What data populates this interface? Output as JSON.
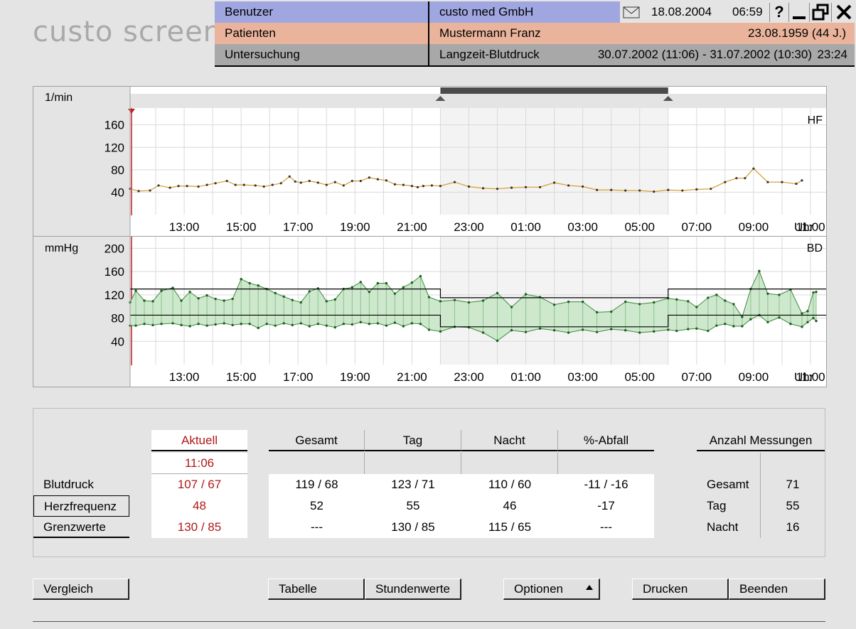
{
  "app": {
    "logo": "custo screen"
  },
  "header": {
    "row1": {
      "label": "Benutzer",
      "value": "custo med GmbH",
      "date": "18.08.2004",
      "time": "06:59"
    },
    "row2": {
      "label": "Patienten",
      "value": "Mustermann Franz",
      "dob": "23.08.1959 (44 J.)"
    },
    "row3": {
      "label": "Untersuchung",
      "value": "Langzeit-Blutdruck",
      "range": "30.07.2002 (11:06) - 31.07.2002 (10:30)",
      "duration": "23:24"
    },
    "icons": {
      "mail": "envelope-icon",
      "help": "?",
      "minimize": "minimize-icon",
      "restore": "restore-icon",
      "close": "close-icon"
    }
  },
  "colors": {
    "hf_line": "#d79a2c",
    "bp_fill": "#cde8cd",
    "bp_line": "#3d8a3d",
    "bp_dark": "#1f5f1f",
    "night_shade": "#f3f3f3",
    "accent_red": "#b01717"
  },
  "chart_data": [
    {
      "type": "line",
      "ylabel": "1/min",
      "tag": "HF",
      "xunit": "Uhr",
      "xticks": [
        "13:00",
        "15:00",
        "17:00",
        "19:00",
        "21:00",
        "23:00",
        "01:00",
        "03:00",
        "05:00",
        "07:00",
        "09:00",
        "11:00"
      ],
      "yticks": [
        40,
        80,
        120,
        160
      ],
      "ylim": [
        0,
        190
      ],
      "xlim_hours": [
        11.1,
        35.5
      ],
      "night_hours": [
        22,
        30
      ],
      "x_hours": [
        11.1,
        11.4,
        11.8,
        12.1,
        12.5,
        12.8,
        13.1,
        13.5,
        13.8,
        14.1,
        14.5,
        14.8,
        15.1,
        15.5,
        15.8,
        16.1,
        16.4,
        16.7,
        16.9,
        17.1,
        17.4,
        17.7,
        18.0,
        18.3,
        18.6,
        18.9,
        19.2,
        19.5,
        19.8,
        20.1,
        20.4,
        20.7,
        21.0,
        21.2,
        21.4,
        21.7,
        22.0,
        22.5,
        23.0,
        23.5,
        24.0,
        24.5,
        25.0,
        25.5,
        26.0,
        26.5,
        27.0,
        27.5,
        28.0,
        28.5,
        29.0,
        29.5,
        30.0,
        30.5,
        31.0,
        31.5,
        32.0,
        32.4,
        32.7,
        33.0,
        33.5,
        34.0,
        34.5,
        34.7
      ],
      "values": [
        46,
        42,
        43,
        52,
        48,
        51,
        51,
        50,
        53,
        56,
        60,
        53,
        53,
        52,
        50,
        53,
        56,
        68,
        59,
        57,
        60,
        57,
        53,
        58,
        52,
        60,
        60,
        66,
        63,
        61,
        54,
        53,
        51,
        49,
        51,
        52,
        51,
        58,
        50,
        47,
        46,
        48,
        49,
        49,
        57,
        52,
        50,
        44,
        44,
        43,
        43,
        41,
        44,
        43,
        45,
        46,
        58,
        65,
        65,
        82,
        58,
        58,
        55,
        61
      ],
      "series": []
    },
    {
      "type": "area",
      "ylabel": "mmHg",
      "tag": "BD",
      "xunit": "Uhr",
      "xticks": [
        "13:00",
        "15:00",
        "17:00",
        "19:00",
        "21:00",
        "23:00",
        "01:00",
        "03:00",
        "05:00",
        "07:00",
        "09:00",
        "11:00"
      ],
      "yticks": [
        40,
        80,
        120,
        160,
        200
      ],
      "ylim": [
        0,
        220
      ],
      "xlim_hours": [
        11.1,
        35.5
      ],
      "night_hours": [
        22,
        30
      ],
      "limits": {
        "day": [
          130,
          85
        ],
        "night": [
          115,
          65
        ]
      },
      "series": [
        {
          "values": [
            107,
            127,
            110,
            109,
            127,
            132,
            110,
            125,
            114,
            119,
            113,
            110,
            113,
            147,
            140,
            136,
            130,
            123,
            117,
            111,
            107,
            126,
            131,
            109,
            112,
            130,
            133,
            142,
            125,
            140,
            140,
            122,
            133,
            141,
            152,
            116,
            109,
            111,
            107,
            110,
            123,
            99,
            121,
            116,
            103,
            108,
            108,
            90,
            91,
            108,
            104,
            107,
            114,
            112,
            109,
            99,
            115,
            120,
            110,
            104,
            82,
            130,
            161,
            122,
            120,
            129,
            88,
            92,
            124,
            125
          ]
        },
        {
          "values": [
            67,
            67,
            70,
            68,
            70,
            71,
            68,
            66,
            70,
            67,
            69,
            71,
            68,
            70,
            70,
            63,
            70,
            67,
            71,
            68,
            71,
            66,
            70,
            67,
            64,
            70,
            69,
            73,
            70,
            71,
            67,
            72,
            66,
            71,
            70,
            60,
            57,
            65,
            64,
            55,
            41,
            59,
            56,
            62,
            59,
            55,
            60,
            56,
            61,
            59,
            55,
            57,
            60,
            58,
            61,
            62,
            58,
            67,
            70,
            66,
            66,
            78,
            85,
            73,
            81,
            70,
            65,
            73,
            80,
            75,
            69,
            74
          ]
        }
      ],
      "x_hours": [
        11.1,
        11.3,
        11.6,
        11.9,
        12.2,
        12.6,
        12.9,
        13.2,
        13.5,
        13.8,
        14.1,
        14.4,
        14.7,
        15.0,
        15.3,
        15.6,
        15.9,
        16.2,
        16.5,
        16.8,
        17.1,
        17.4,
        17.7,
        18.0,
        18.3,
        18.6,
        18.9,
        19.2,
        19.5,
        19.8,
        20.1,
        20.4,
        20.7,
        21.0,
        21.3,
        21.6,
        22.0,
        22.5,
        23.0,
        23.5,
        24.0,
        24.5,
        25.0,
        25.5,
        26.0,
        26.5,
        27.0,
        27.5,
        28.0,
        28.5,
        29.0,
        29.5,
        30.0,
        30.3,
        30.7,
        31.0,
        31.4,
        31.7,
        32.0,
        32.3,
        32.6,
        32.9,
        33.2,
        33.5,
        33.9,
        34.3,
        34.7,
        34.9,
        35.1,
        35.2,
        35.3,
        35.4
      ]
    }
  ],
  "stats": {
    "aktuell_header": "Aktuell",
    "aktuell_time": "11:06",
    "col_headers": [
      "Gesamt",
      "Tag",
      "Nacht",
      "%-Abfall"
    ],
    "rows": [
      {
        "label": "Blutdruck",
        "aktuell": "107 /  67",
        "values": [
          "119 /  68",
          "123 / 71",
          "110 / 60",
          "-11 / -16"
        ]
      },
      {
        "label": "Herzfrequenz",
        "aktuell": "48",
        "values": [
          "52",
          "55",
          "46",
          "-17"
        ]
      },
      {
        "label": "Grenzwerte",
        "aktuell": "130 /  85",
        "values": [
          "---",
          "130 / 85",
          "115 / 65",
          "---"
        ]
      }
    ],
    "count_header": "Anzahl Messungen",
    "counts": [
      {
        "label": "Gesamt",
        "value": "71"
      },
      {
        "label": "Tag",
        "value": "55"
      },
      {
        "label": "Nacht",
        "value": "16"
      }
    ]
  },
  "buttons": {
    "vergleich": "Vergleich",
    "tabelle": "Tabelle",
    "stundenwerte": "Stundenwerte",
    "optionen": "Optionen",
    "drucken": "Drucken",
    "beenden": "Beenden"
  }
}
